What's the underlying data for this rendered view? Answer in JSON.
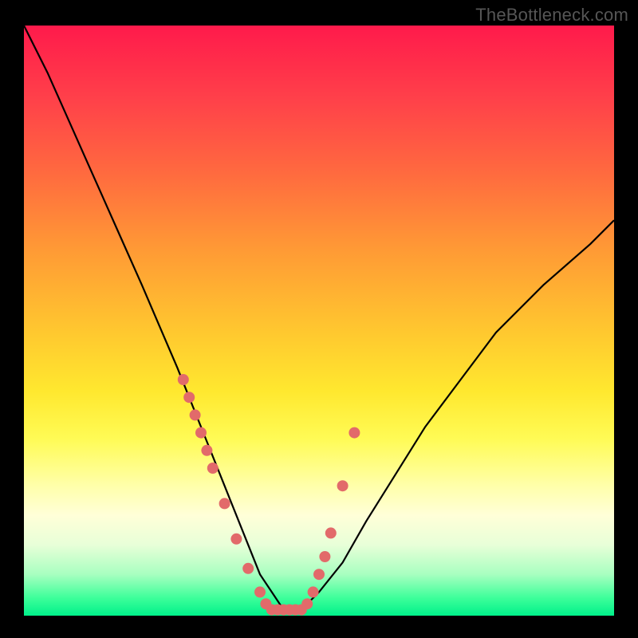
{
  "watermark": "TheBottleneck.com",
  "chart_data": {
    "type": "line",
    "title": "",
    "xlabel": "",
    "ylabel": "",
    "xlim": [
      0,
      100
    ],
    "ylim": [
      0,
      100
    ],
    "series": [
      {
        "name": "bottleneck-curve",
        "x": [
          0,
          4,
          8,
          12,
          16,
          20,
          23,
          26,
          28,
          30,
          32,
          34,
          36,
          38,
          40,
          42,
          44,
          47,
          50,
          54,
          58,
          63,
          68,
          74,
          80,
          88,
          96,
          100
        ],
        "y": [
          100,
          92,
          83,
          74,
          65,
          56,
          49,
          42,
          37,
          32,
          27,
          22,
          17,
          12,
          7,
          4,
          1,
          1,
          4,
          9,
          16,
          24,
          32,
          40,
          48,
          56,
          63,
          67
        ]
      }
    ],
    "markers": {
      "name": "sample-points",
      "color": "#e26a6a",
      "x": [
        27,
        28,
        29,
        30,
        31,
        32,
        34,
        36,
        38,
        40,
        41,
        42,
        43,
        44,
        45,
        46,
        47,
        48,
        49,
        50,
        51,
        52,
        54,
        56
      ],
      "y": [
        40,
        37,
        34,
        31,
        28,
        25,
        19,
        13,
        8,
        4,
        2,
        1,
        1,
        1,
        1,
        1,
        1,
        2,
        4,
        7,
        10,
        14,
        22,
        31
      ]
    }
  }
}
